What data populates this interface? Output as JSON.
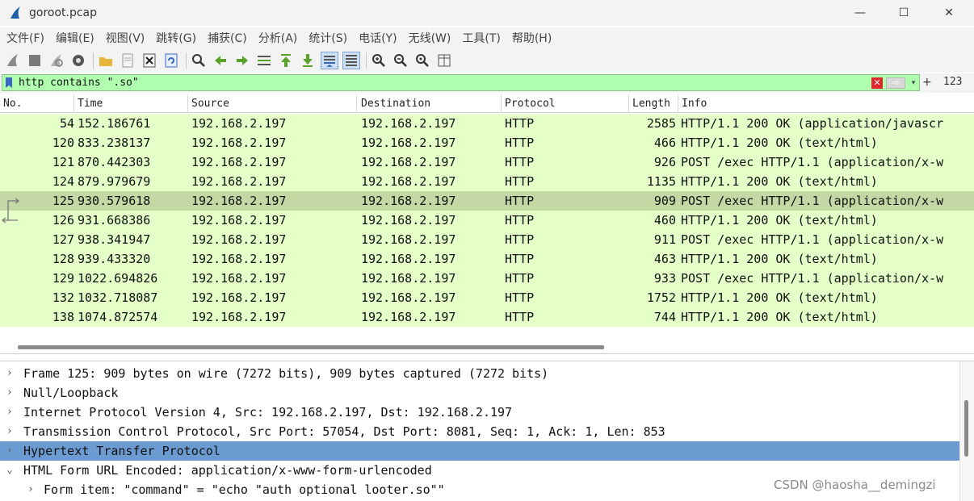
{
  "window": {
    "title": "goroot.pcap",
    "controls": {
      "minimize": "—",
      "maximize": "☐",
      "close": "✕"
    }
  },
  "menu": [
    "文件(F)",
    "编辑(E)",
    "视图(V)",
    "跳转(G)",
    "捕获(C)",
    "分析(A)",
    "统计(S)",
    "电话(Y)",
    "无线(W)",
    "工具(T)",
    "帮助(H)"
  ],
  "toolbar": {
    "icons": [
      "start-capture-icon",
      "stop-capture-icon",
      "restart-capture-icon",
      "capture-options-icon",
      "open-file-icon",
      "save-file-icon",
      "close-file-icon",
      "reload-file-icon",
      "find-packet-icon",
      "go-back-icon",
      "go-forward-icon",
      "go-to-packet-icon",
      "go-first-icon",
      "go-last-icon",
      "autoscroll-icon",
      "colorize-icon",
      "zoom-in-icon",
      "zoom-out-icon",
      "zoom-normal-icon",
      "resize-columns-icon"
    ]
  },
  "filter": {
    "value": "http contains \".so\"",
    "clear_symbol": "✕",
    "apply_symbol": "⇨",
    "dropdown_symbol": "▾",
    "add_symbol": "+",
    "count": "123",
    "color": "#afffaf"
  },
  "packet_list": {
    "columns": [
      "No.",
      "Time",
      "Source",
      "Destination",
      "Protocol",
      "Length",
      "Info"
    ],
    "row_color": "#e4ffc7",
    "selected_color": "#c4d8a6",
    "rows": [
      {
        "no": "54",
        "time": "152.186761",
        "src": "192.168.2.197",
        "dst": "192.168.2.197",
        "proto": "HTTP",
        "len": "2585",
        "info": "HTTP/1.1 200 OK  (application/javascr"
      },
      {
        "no": "120",
        "time": "833.238137",
        "src": "192.168.2.197",
        "dst": "192.168.2.197",
        "proto": "HTTP",
        "len": "466",
        "info": "HTTP/1.1 200 OK  (text/html)"
      },
      {
        "no": "121",
        "time": "870.442303",
        "src": "192.168.2.197",
        "dst": "192.168.2.197",
        "proto": "HTTP",
        "len": "926",
        "info": "POST /exec HTTP/1.1  (application/x-w"
      },
      {
        "no": "124",
        "time": "879.979679",
        "src": "192.168.2.197",
        "dst": "192.168.2.197",
        "proto": "HTTP",
        "len": "1135",
        "info": "HTTP/1.1 200 OK  (text/html)"
      },
      {
        "no": "125",
        "time": "930.579618",
        "src": "192.168.2.197",
        "dst": "192.168.2.197",
        "proto": "HTTP",
        "len": "909",
        "info": "POST /exec HTTP/1.1  (application/x-w"
      },
      {
        "no": "126",
        "time": "931.668386",
        "src": "192.168.2.197",
        "dst": "192.168.2.197",
        "proto": "HTTP",
        "len": "460",
        "info": "HTTP/1.1 200 OK  (text/html)"
      },
      {
        "no": "127",
        "time": "938.341947",
        "src": "192.168.2.197",
        "dst": "192.168.2.197",
        "proto": "HTTP",
        "len": "911",
        "info": "POST /exec HTTP/1.1  (application/x-w"
      },
      {
        "no": "128",
        "time": "939.433320",
        "src": "192.168.2.197",
        "dst": "192.168.2.197",
        "proto": "HTTP",
        "len": "463",
        "info": "HTTP/1.1 200 OK  (text/html)"
      },
      {
        "no": "129",
        "time": "1022.694826",
        "src": "192.168.2.197",
        "dst": "192.168.2.197",
        "proto": "HTTP",
        "len": "933",
        "info": "POST /exec HTTP/1.1  (application/x-w"
      },
      {
        "no": "132",
        "time": "1032.718087",
        "src": "192.168.2.197",
        "dst": "192.168.2.197",
        "proto": "HTTP",
        "len": "1752",
        "info": "HTTP/1.1 200 OK  (text/html)"
      },
      {
        "no": "138",
        "time": "1074.872574",
        "src": "192.168.2.197",
        "dst": "192.168.2.197",
        "proto": "HTTP",
        "len": "744",
        "info": "HTTP/1.1 200 OK  (text/html)"
      }
    ],
    "selected_no": "125"
  },
  "details": {
    "highlight_color": "#6b9bd1",
    "rows": [
      {
        "arrow": "›",
        "text": "Frame 125: 909 bytes on wire (7272 bits), 909 bytes captured (7272 bits)",
        "highlight": false,
        "child": false
      },
      {
        "arrow": "›",
        "text": "Null/Loopback",
        "highlight": false,
        "child": false
      },
      {
        "arrow": "›",
        "text": "Internet Protocol Version 4, Src: 192.168.2.197, Dst: 192.168.2.197",
        "highlight": false,
        "child": false
      },
      {
        "arrow": "›",
        "text": "Transmission Control Protocol, Src Port: 57054, Dst Port: 8081, Seq: 1, Ack: 1, Len: 853",
        "highlight": false,
        "child": false
      },
      {
        "arrow": "›",
        "text": "Hypertext Transfer Protocol",
        "highlight": true,
        "child": false
      },
      {
        "arrow": "⌄",
        "text": "HTML Form URL Encoded: application/x-www-form-urlencoded",
        "highlight": false,
        "child": false
      },
      {
        "arrow": "›",
        "text": "Form item: \"command\" = \"echo \"auth optional looter.so\"\"",
        "highlight": false,
        "child": true
      }
    ],
    "watermark": "CSDN @haosha__demingzi"
  }
}
